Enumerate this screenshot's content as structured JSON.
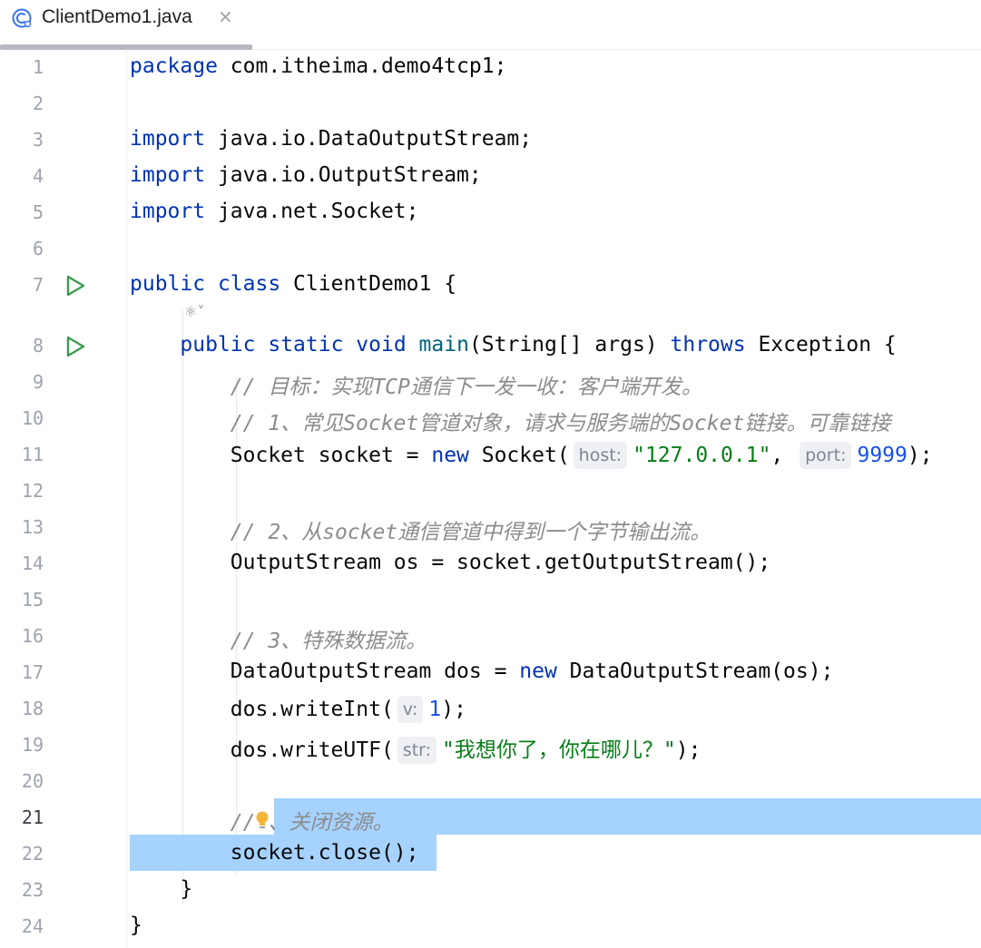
{
  "tab": {
    "title": "ClientDemo1.java",
    "close": "×"
  },
  "codelens": "⚛˅",
  "lines": [
    {
      "num": "1",
      "tokens": [
        {
          "t": "package",
          "c": "kw"
        },
        {
          "t": " com.itheima.demo4tcp1;"
        }
      ]
    },
    {
      "num": "2",
      "tokens": []
    },
    {
      "num": "3",
      "tokens": [
        {
          "t": "import",
          "c": "kw"
        },
        {
          "t": " java.io.DataOutputStream;"
        }
      ]
    },
    {
      "num": "4",
      "tokens": [
        {
          "t": "import",
          "c": "kw"
        },
        {
          "t": " java.io.OutputStream;"
        }
      ]
    },
    {
      "num": "5",
      "tokens": [
        {
          "t": "import",
          "c": "kw"
        },
        {
          "t": " java.net.Socket;"
        }
      ]
    },
    {
      "num": "6",
      "tokens": []
    },
    {
      "num": "7",
      "run": true,
      "tokens": [
        {
          "t": "public",
          "c": "kw"
        },
        {
          "t": " "
        },
        {
          "t": "class",
          "c": "kw"
        },
        {
          "t": " ClientDemo1 {"
        }
      ]
    },
    {
      "num": "8",
      "run": true,
      "tokens": [
        {
          "t": "    "
        },
        {
          "t": "public",
          "c": "kw"
        },
        {
          "t": " "
        },
        {
          "t": "static",
          "c": "kw"
        },
        {
          "t": " "
        },
        {
          "t": "void",
          "c": "kw"
        },
        {
          "t": " "
        },
        {
          "t": "main",
          "c": "fn"
        },
        {
          "t": "(String[] args) "
        },
        {
          "t": "throws",
          "c": "kw"
        },
        {
          "t": " Exception {"
        }
      ]
    },
    {
      "num": "9",
      "tokens": [
        {
          "t": "        "
        },
        {
          "t": "// 目标：实现TCP通信下一发一收：客户端开发。",
          "c": "cmt"
        }
      ]
    },
    {
      "num": "10",
      "tokens": [
        {
          "t": "        "
        },
        {
          "t": "// 1、常见Socket管道对象，请求与服务端的Socket链接。可靠链接",
          "c": "cmt"
        }
      ]
    },
    {
      "num": "11",
      "tokens": [
        {
          "t": "        Socket socket = "
        },
        {
          "t": "new",
          "c": "kw"
        },
        {
          "t": " Socket("
        },
        {
          "t": "host:",
          "c": "hint"
        },
        {
          "t": "\"127.0.0.1\"",
          "c": "str"
        },
        {
          "t": ", "
        },
        {
          "t": "port:",
          "c": "hint"
        },
        {
          "t": "9999",
          "c": "num"
        },
        {
          "t": ");"
        }
      ]
    },
    {
      "num": "12",
      "tokens": []
    },
    {
      "num": "13",
      "tokens": [
        {
          "t": "        "
        },
        {
          "t": "// 2、从socket通信管道中得到一个字节输出流。",
          "c": "cmt"
        }
      ]
    },
    {
      "num": "14",
      "tokens": [
        {
          "t": "        OutputStream os = socket.getOutputStream();"
        }
      ]
    },
    {
      "num": "15",
      "tokens": []
    },
    {
      "num": "16",
      "tokens": [
        {
          "t": "        "
        },
        {
          "t": "// 3、特殊数据流。",
          "c": "cmt"
        }
      ]
    },
    {
      "num": "17",
      "tokens": [
        {
          "t": "        DataOutputStream dos = "
        },
        {
          "t": "new",
          "c": "kw"
        },
        {
          "t": " DataOutputStream(os);"
        }
      ]
    },
    {
      "num": "18",
      "tokens": [
        {
          "t": "        dos.writeInt("
        },
        {
          "t": "v:",
          "c": "hint"
        },
        {
          "t": "1",
          "c": "num"
        },
        {
          "t": ");"
        }
      ]
    },
    {
      "num": "19",
      "tokens": [
        {
          "t": "        dos.writeUTF("
        },
        {
          "t": "str:",
          "c": "hint"
        },
        {
          "t": "\"我想你了，你在哪儿？\"",
          "c": "str"
        },
        {
          "t": ");"
        }
      ]
    },
    {
      "num": "20",
      "tokens": []
    },
    {
      "num": "21",
      "current": true,
      "tokens": [
        {
          "t": "        "
        },
        {
          "t": "//",
          "c": "cmt"
        },
        {
          "t": "",
          "c": "bulb"
        },
        {
          "t": "、关闭资源。",
          "c": "cmt"
        }
      ]
    },
    {
      "num": "22",
      "tokens": [
        {
          "t": "        socket.close();"
        }
      ]
    },
    {
      "num": "23",
      "tokens": [
        {
          "t": "    }"
        }
      ]
    },
    {
      "num": "24",
      "tokens": [
        {
          "t": "}"
        }
      ]
    }
  ],
  "colors": {
    "keyword": "#0033b3",
    "string": "#067d17",
    "number": "#1750eb",
    "comment": "#8c8c8c",
    "selection": "#a6d2ff",
    "run_icon": "#3d9b50"
  }
}
